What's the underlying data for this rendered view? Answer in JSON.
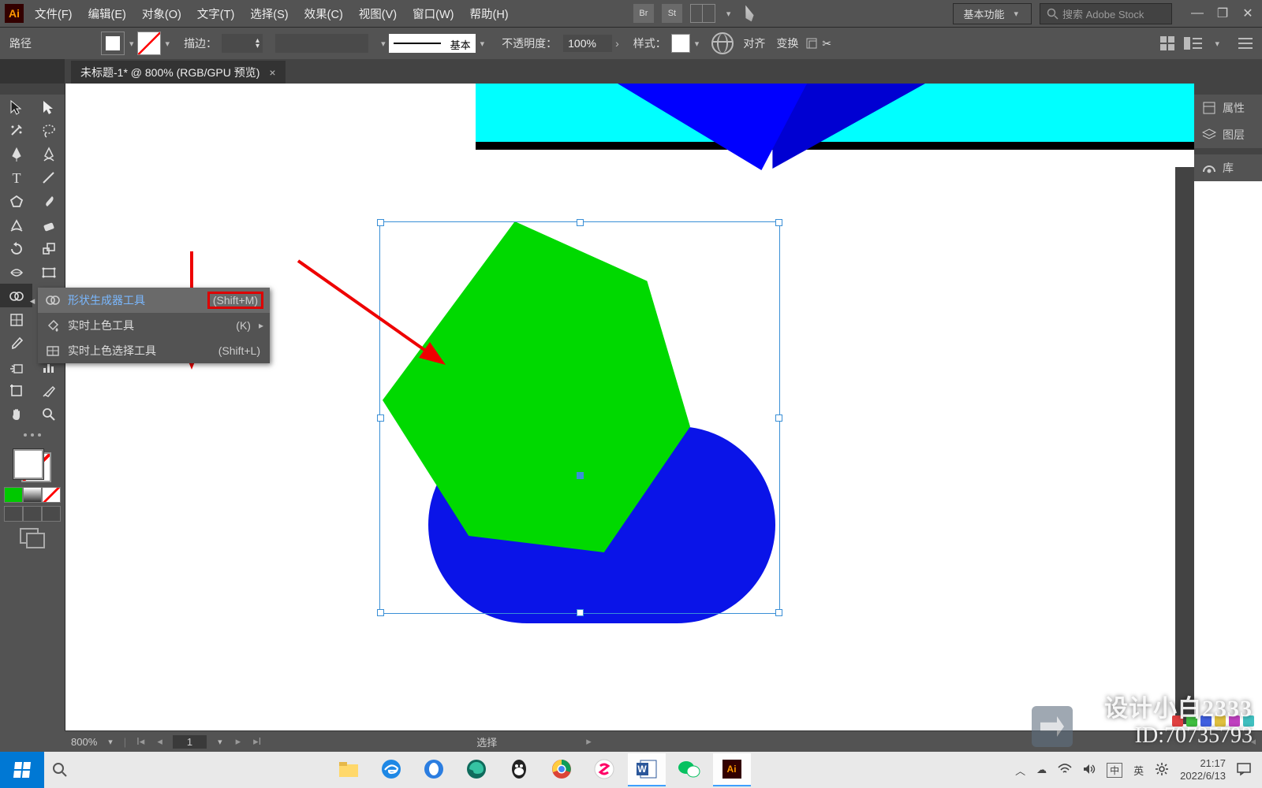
{
  "menubar": {
    "logo": "Ai",
    "items": [
      "文件(F)",
      "编辑(E)",
      "对象(O)",
      "文字(T)",
      "选择(S)",
      "效果(C)",
      "视图(V)",
      "窗口(W)",
      "帮助(H)"
    ],
    "br": "Br",
    "st": "St",
    "workspace": "基本功能",
    "search_placeholder": "搜索 Adobe Stock"
  },
  "optbar": {
    "left_label": "路径",
    "stroke_label": "描边：",
    "brush_label": "基本",
    "opacity_label": "不透明度：",
    "opacity_value": "100%",
    "style_label": "样式：",
    "align": "对齐",
    "transform": "变换"
  },
  "tab": {
    "title": "未标题-1* @ 800% (RGB/GPU 预览)"
  },
  "flyout": {
    "items": [
      {
        "name": "形状生成器工具",
        "shortcut": "(Shift+M)"
      },
      {
        "name": "实时上色工具",
        "shortcut": "(K)"
      },
      {
        "name": "实时上色选择工具",
        "shortcut": "(Shift+L)"
      }
    ]
  },
  "right_panels": {
    "items": [
      "属性",
      "图层",
      "库"
    ]
  },
  "statusbar": {
    "zoom": "800%",
    "page": "1",
    "mid": "选择"
  },
  "taskbar": {
    "time": "21:17",
    "date": "2022/6/13",
    "ime1": "中",
    "ime2": "英"
  },
  "watermark": {
    "line1": "设计小白2333",
    "line2": "ID:70735793"
  },
  "chart_data": null
}
